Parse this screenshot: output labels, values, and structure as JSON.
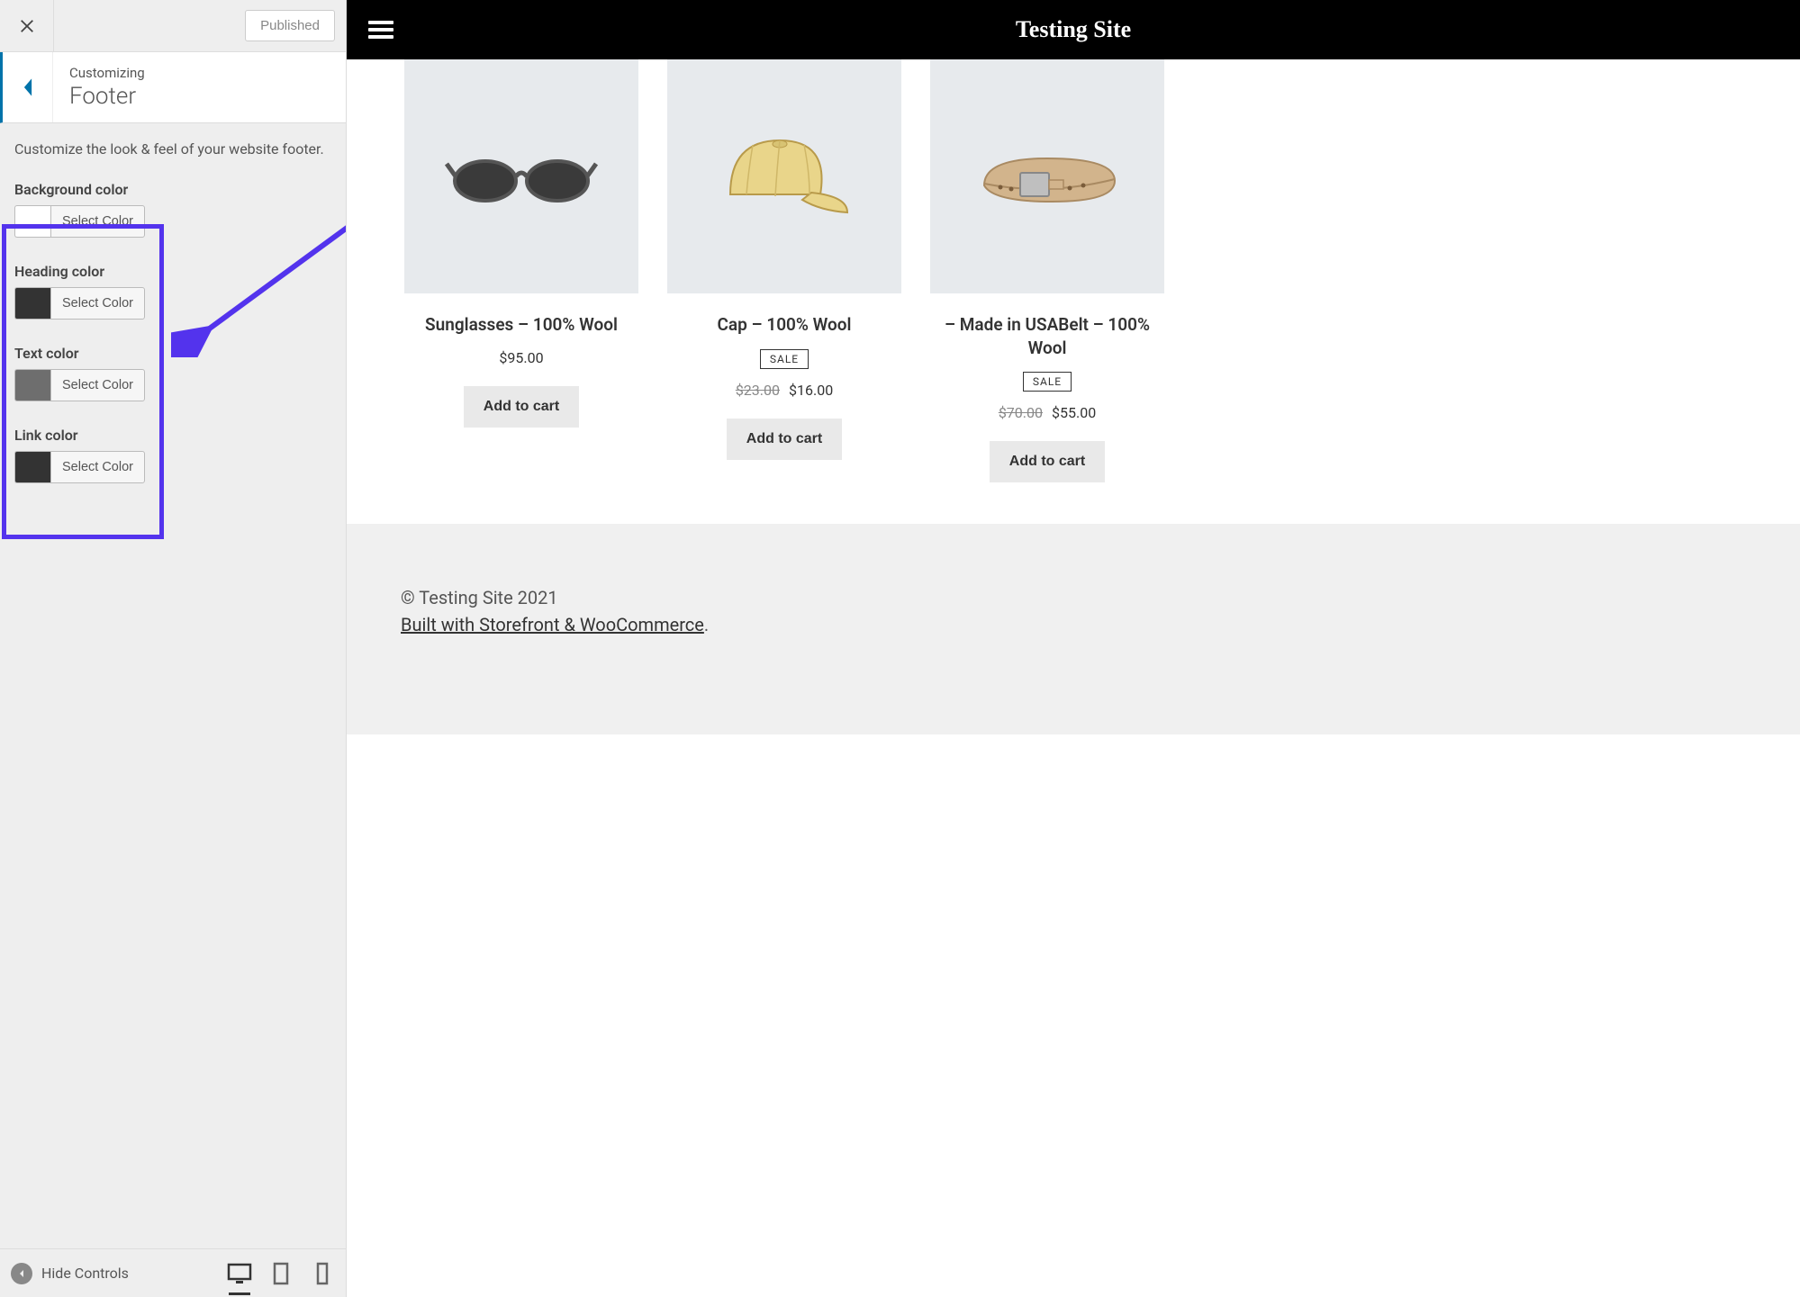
{
  "sidebar": {
    "published_label": "Published",
    "eyebrow": "Customizing",
    "section_name": "Footer",
    "help_text": "Customize the look & feel of your website footer.",
    "hide_controls": "Hide Controls",
    "color_controls": [
      {
        "label": "Background color",
        "button": "Select Color",
        "swatch": "#ffffff"
      },
      {
        "label": "Heading color",
        "button": "Select Color",
        "swatch": "#333333"
      },
      {
        "label": "Text color",
        "button": "Select Color",
        "swatch": "#6e6e6e"
      },
      {
        "label": "Link color",
        "button": "Select Color",
        "swatch": "#333333"
      }
    ],
    "annotation": {
      "highlight_color": "#5333ed"
    }
  },
  "preview": {
    "site_title": "Testing Site",
    "products": [
      {
        "title": "Sunglasses – 100% Wool",
        "sale": false,
        "old_price": "",
        "price": "$95.00",
        "cta": "Add to cart",
        "icon": "sunglasses"
      },
      {
        "title": "Cap – 100% Wool",
        "sale": true,
        "sale_label": "SALE",
        "old_price": "$23.00",
        "price": "$16.00",
        "cta": "Add to cart",
        "icon": "cap"
      },
      {
        "title": " – Made in USABelt – 100% Wool",
        "sale": true,
        "sale_label": "SALE",
        "old_price": "$70.00",
        "price": "$55.00",
        "cta": "Add to cart",
        "icon": "belt"
      }
    ],
    "footer_copy": "© Testing Site 2021",
    "footer_built": "Built with Storefront & WooCommerce",
    "footer_period": "."
  }
}
